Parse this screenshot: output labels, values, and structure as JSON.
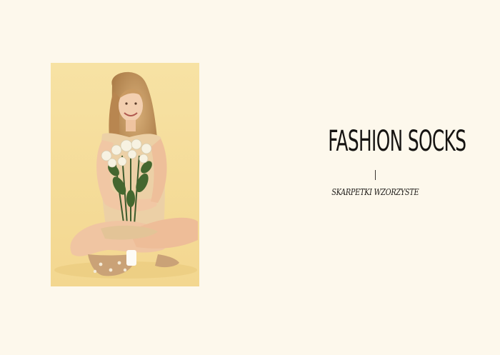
{
  "hero": {
    "title": "FASHION SOCKS",
    "subtitle": "SKARPETKI WZORZYSTE"
  },
  "colors": {
    "page_background": "#fdf8ec",
    "photo_background": "#f6dfa0",
    "text": "#161412"
  },
  "photo": {
    "icon": "model-photo"
  }
}
